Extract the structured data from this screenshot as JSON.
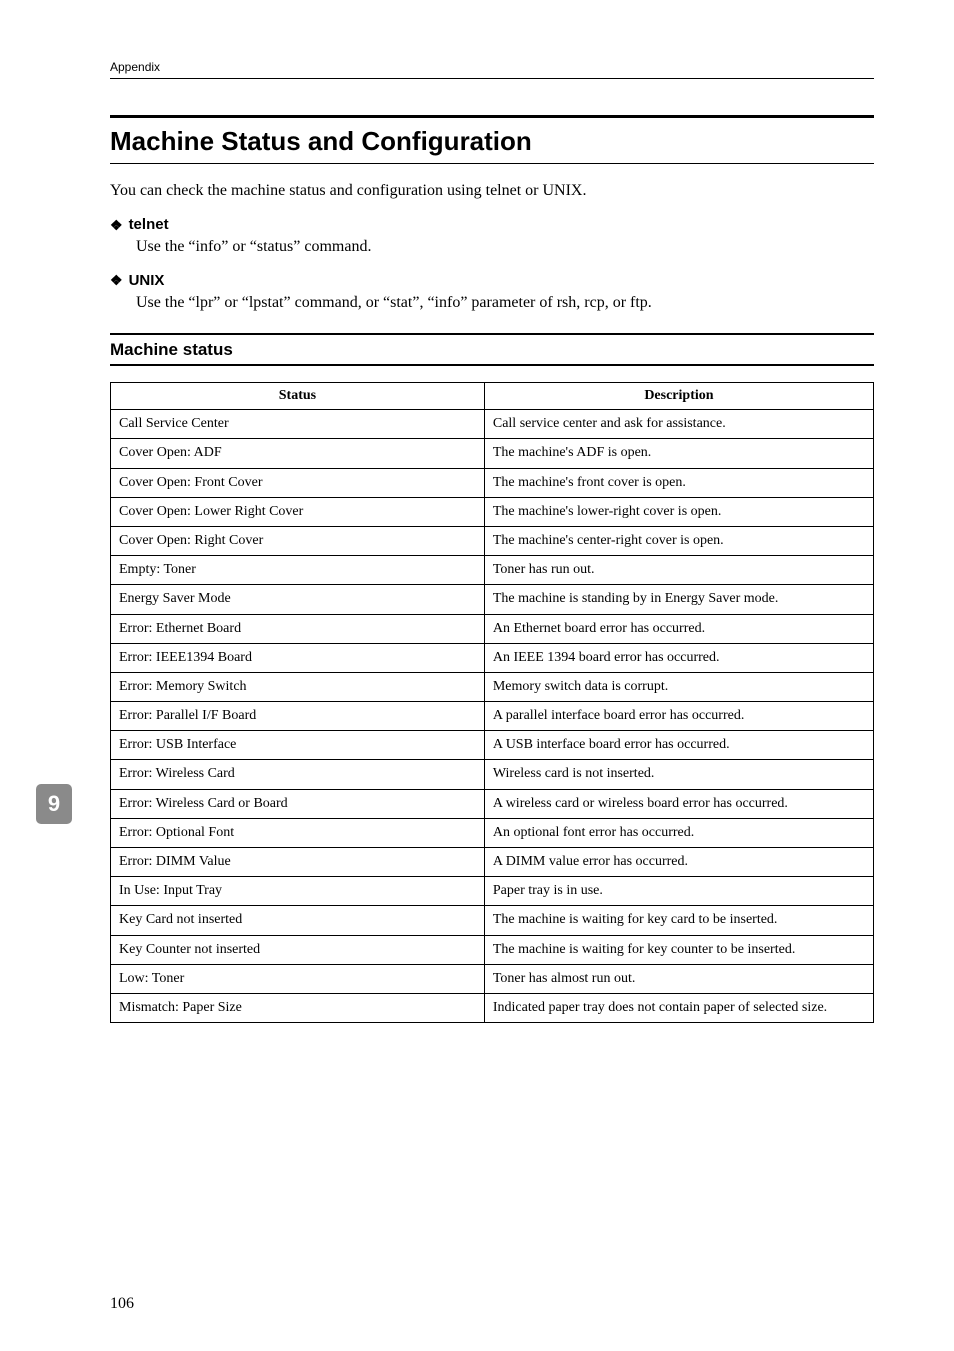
{
  "running_head": "Appendix",
  "section_title": "Machine Status and Configuration",
  "intro": "You can check the machine status and configuration using telnet or UNIX.",
  "subs": [
    {
      "head": "telnet",
      "body": "Use the “info” or “status” command."
    },
    {
      "head": "UNIX",
      "body": "Use the “lpr” or “lpstat” command, or “stat”, “info” parameter of rsh, rcp, or ftp."
    }
  ],
  "table_title": "Machine status",
  "table_headers": {
    "status": "Status",
    "description": "Description"
  },
  "rows": [
    {
      "s": "Call Service Center",
      "d": "Call service center and ask for assistance."
    },
    {
      "s": "Cover Open: ADF",
      "d": "The machine's ADF is open."
    },
    {
      "s": "Cover Open: Front Cover",
      "d": "The machine's front cover is open."
    },
    {
      "s": "Cover Open: Lower Right Cover",
      "d": "The machine's lower-right cover is open."
    },
    {
      "s": "Cover Open: Right Cover",
      "d": "The machine's center-right cover is open."
    },
    {
      "s": "Empty: Toner",
      "d": "Toner has run out."
    },
    {
      "s": "Energy Saver Mode",
      "d": "The machine is standing by in Energy Saver mode."
    },
    {
      "s": "Error: Ethernet Board",
      "d": "An Ethernet board error has occurred."
    },
    {
      "s": "Error: IEEE1394 Board",
      "d": "An IEEE 1394 board error has occurred."
    },
    {
      "s": "Error: Memory Switch",
      "d": "Memory switch data is corrupt."
    },
    {
      "s": "Error: Parallel I/F Board",
      "d": "A parallel interface board error has occurred."
    },
    {
      "s": "Error: USB Interface",
      "d": "A USB interface board error has occurred."
    },
    {
      "s": "Error: Wireless Card",
      "d": "Wireless card is not inserted."
    },
    {
      "s": "Error: Wireless Card or Board",
      "d": "A wireless card or wireless board error has occurred."
    },
    {
      "s": "Error: Optional Font",
      "d": "An optional font error has occurred."
    },
    {
      "s": "Error: DIMM Value",
      "d": "A DIMM value error has occurred."
    },
    {
      "s": "In Use: Input Tray",
      "d": "Paper tray is in use."
    },
    {
      "s": "Key Card not inserted",
      "d": "The machine is waiting for key card to be inserted."
    },
    {
      "s": "Key Counter not inserted",
      "d": "The machine is waiting for key counter to be inserted."
    },
    {
      "s": "Low: Toner",
      "d": "Toner has almost run out."
    },
    {
      "s": "Mismatch: Paper Size",
      "d": "Indicated paper tray does not contain paper of selected size."
    }
  ],
  "side_tab": "9",
  "page_number": "106",
  "glyphs": {
    "diamond": "❖"
  }
}
